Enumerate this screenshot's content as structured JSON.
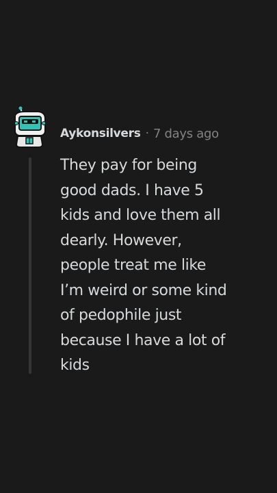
{
  "comment": {
    "author": "Aykonsilvers",
    "separator": "·",
    "time_ago": "7 days ago",
    "body_lines": [
      "They pay for being",
      "good dads. I have 5",
      "kids and love them all",
      "dearly. However,",
      "people treat me like",
      "I’m weird or some kind",
      "of pedophile just",
      "because I have a lot of",
      "kids"
    ]
  },
  "colors": {
    "background": "#1a1a1b",
    "text_primary": "#d7dadc",
    "text_secondary": "#818384",
    "thread_line": "#343536",
    "avatar_accent": "#2ec4b6"
  },
  "icons": {
    "avatar": "robot-avatar-icon"
  }
}
